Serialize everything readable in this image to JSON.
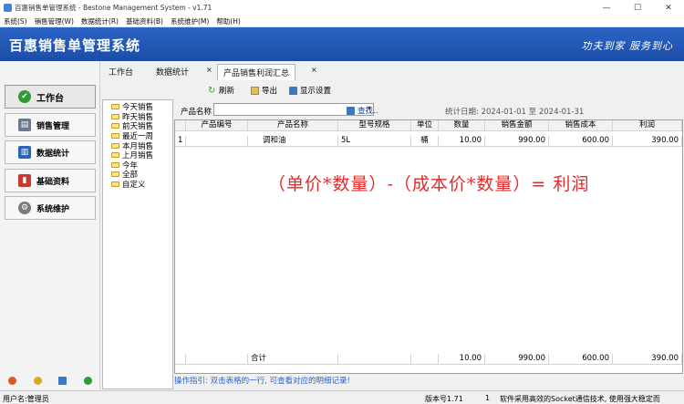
{
  "window": {
    "title": "百惠销售单管理系统 - Bestone Management System - v1.71",
    "controls": {
      "minimize": "—",
      "maximize": "☐",
      "close": "✕"
    }
  },
  "menu": [
    "系统(S)",
    "销售管理(W)",
    "数据统计(R)",
    "基础资料(B)",
    "系统维护(M)",
    "帮助(H)"
  ],
  "banner": {
    "title": "百惠销售单管理系统",
    "slogan": "功夫到家 服务到心"
  },
  "sidebar": {
    "items": [
      {
        "label": "工作台",
        "icon": "check-icon",
        "color": "#2e9b34"
      },
      {
        "label": "销售管理",
        "icon": "printer-icon",
        "color": "#6b7a8c"
      },
      {
        "label": "数据统计",
        "icon": "chart-icon",
        "color": "#2c63b6"
      },
      {
        "label": "基础资料",
        "icon": "book-icon",
        "color": "#c93a2e"
      },
      {
        "label": "系统维护",
        "icon": "gear-icon",
        "color": "#7a7a7a"
      }
    ]
  },
  "tabs": [
    {
      "label": "工作台"
    },
    {
      "label": "数据统计"
    },
    {
      "label": "产品销售利润汇总"
    }
  ],
  "toolbar": {
    "refresh": "刷新",
    "export": "导出",
    "display_settings": "显示设置"
  },
  "filter": {
    "product_label": "产品名称",
    "product_value": "",
    "find": "查找..",
    "date_range": "统计日期: 2024-01-01 至 2024-01-31"
  },
  "tree": [
    "今天销售",
    "昨天销售",
    "前天销售",
    "最近一周",
    "本月销售",
    "上月销售",
    "今年",
    "全部",
    "自定义"
  ],
  "table": {
    "headers": [
      "",
      "产品编号",
      "产品名称",
      "型号规格",
      "单位",
      "数量",
      "销售金额",
      "销售成本",
      "利润"
    ],
    "rows": [
      [
        "1",
        "",
        "调和油",
        "5L",
        "桶",
        "10.00",
        "990.00",
        "600.00",
        "390.00"
      ]
    ],
    "total": {
      "label": "合计",
      "qty": "10.00",
      "amount": "990.00",
      "cost": "600.00",
      "profit": "390.00"
    }
  },
  "formula": "（单价*数量）-（成本价*数量）= 利润",
  "hint": "操作指引: 双击表格的一行, 可查看对应的明细记录!",
  "status": {
    "user": "用户名:管理员",
    "version": "版本号1.71",
    "count": "1",
    "message": "软件采用高效的Socket通信技术, 使用强大稳定而"
  }
}
